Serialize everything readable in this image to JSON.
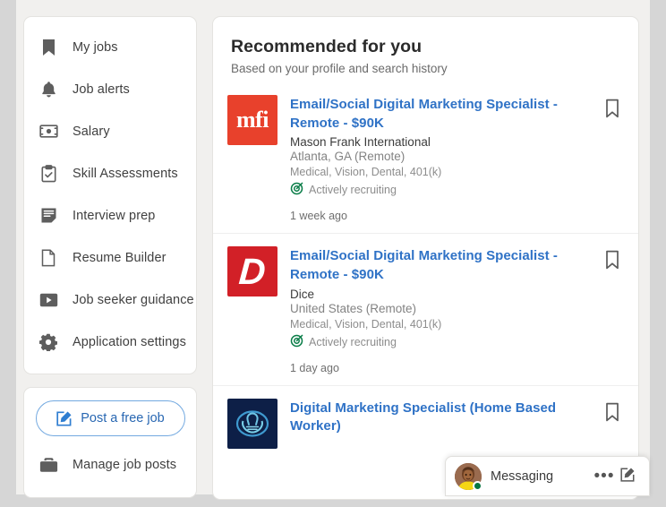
{
  "sidebar": {
    "nav_items": [
      {
        "label": "My jobs",
        "icon": "bookmark-icon"
      },
      {
        "label": "Job alerts",
        "icon": "bell-icon"
      },
      {
        "label": "Salary",
        "icon": "money-icon"
      },
      {
        "label": "Skill Assessments",
        "icon": "clipboard-check-icon"
      },
      {
        "label": "Interview prep",
        "icon": "notes-icon"
      },
      {
        "label": "Resume Builder",
        "icon": "document-icon"
      },
      {
        "label": "Job seeker guidance",
        "icon": "video-play-icon"
      },
      {
        "label": "Application settings",
        "icon": "gear-icon"
      }
    ],
    "post_button": {
      "label": "Post a free job",
      "icon": "compose-icon"
    },
    "manage_item": {
      "label": "Manage job posts",
      "icon": "briefcase-icon"
    }
  },
  "main": {
    "title": "Recommended for you",
    "subtitle": "Based on your profile and search history",
    "jobs": [
      {
        "title": "Email/Social Digital Marketing Specialist - Remote - $90K",
        "company": "Mason Frank International",
        "location": "Atlanta, GA (Remote)",
        "benefits": "Medical, Vision, Dental, 401(k)",
        "recruiting": "Actively recruiting",
        "posted": "1 week ago",
        "logo": {
          "type": "mfi",
          "text": "mfi",
          "bg": "#e8412c",
          "fg": "#ffffff"
        },
        "save_label": "Save job"
      },
      {
        "title": "Email/Social Digital Marketing Specialist - Remote - $90K",
        "company": "Dice",
        "location": "United States (Remote)",
        "benefits": "Medical, Vision, Dental, 401(k)",
        "recruiting": "Actively recruiting",
        "posted": "1 day ago",
        "logo": {
          "type": "dice",
          "text": "D",
          "bg": "#d22027",
          "fg": "#ffffff"
        },
        "save_label": "Save job"
      },
      {
        "title": "Digital Marketing Specialist (Home Based Worker)",
        "company": "",
        "location": "",
        "benefits": "",
        "recruiting": "",
        "posted": "",
        "logo": {
          "type": "allstate",
          "text": "",
          "bg": "#0d1f47",
          "fg": "#4ea8d8"
        },
        "save_label": "Save job"
      }
    ]
  },
  "messaging": {
    "label": "Messaging",
    "more_label": "•••",
    "compose_label": "Compose message",
    "presence": "online"
  },
  "colors": {
    "link_blue": "#2f72c6",
    "accent_blue": "#2867b2",
    "page_bg": "#f1f0ee",
    "outer_bg": "#d6d6d6",
    "recruiting_green": "#0a7d48"
  }
}
